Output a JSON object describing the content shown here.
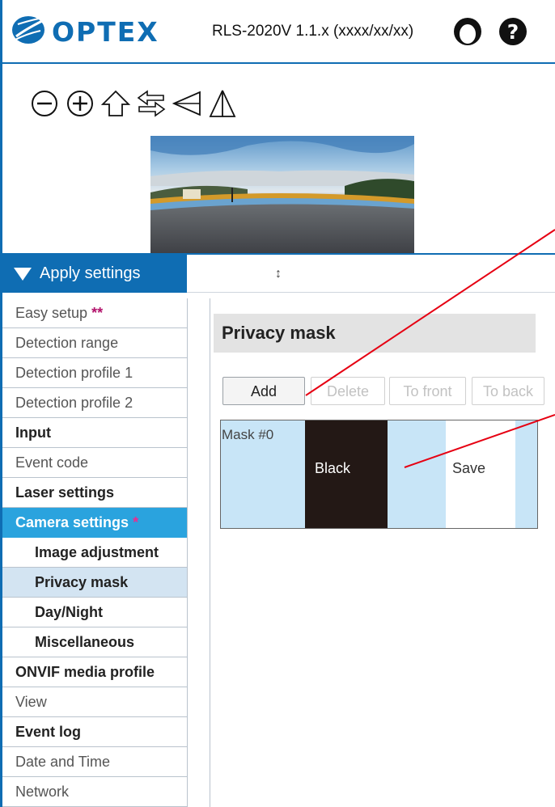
{
  "header": {
    "logo_text": "OPTEX",
    "product_title": "RLS-2020V 1.1.x (xxxx/xx/xx)",
    "icons": [
      "user-icon",
      "help-icon"
    ]
  },
  "preview_toolbar": {
    "icons": [
      "zoom-out-icon",
      "zoom-in-icon",
      "home-arrow-icon",
      "swap-arrows-icon",
      "left-triangle-icon",
      "flip-triangle-icon"
    ]
  },
  "apply": {
    "label": "Apply settings",
    "drag_glyph": "↕"
  },
  "sidebar": {
    "items": [
      {
        "label": "Easy setup",
        "star": "**"
      },
      {
        "label": "Detection range"
      },
      {
        "label": "Detection profile 1"
      },
      {
        "label": "Detection profile 2"
      },
      {
        "label": "Input"
      },
      {
        "label": "Event code"
      },
      {
        "label": "Laser settings"
      },
      {
        "label": "Camera settings",
        "star": "*"
      },
      {
        "label": "Image adjustment"
      },
      {
        "label": "Privacy mask"
      },
      {
        "label": "Day/Night"
      },
      {
        "label": "Miscellaneous"
      },
      {
        "label": "ONVIF media profile"
      },
      {
        "label": "View"
      },
      {
        "label": "Event log"
      },
      {
        "label": "Date and Time"
      },
      {
        "label": "Network"
      }
    ]
  },
  "content": {
    "section_title": "Privacy mask",
    "buttons": {
      "add": "Add",
      "delete": "Delete",
      "to_front": "To front",
      "to_back": "To back"
    },
    "mask": {
      "label": "Mask #0",
      "color": "Black",
      "save": "Save"
    }
  },
  "colors": {
    "brand_blue": "#0f6db3",
    "active_item": "#2aa3de",
    "selected_item": "#d3e4f2",
    "mask_area": "#c8e5f7",
    "mask_black": "#231815",
    "annotation": "#e60012"
  }
}
